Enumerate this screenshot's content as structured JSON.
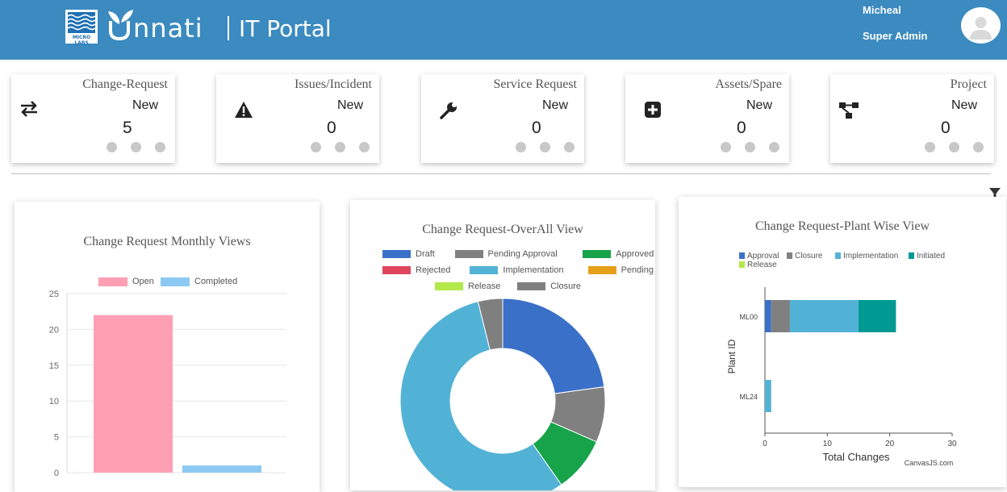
{
  "header": {
    "logo_text": "MICRO LABS",
    "brand_name": "nnati",
    "portal_label": "IT Portal",
    "user_name": "Micheal",
    "user_role": "Super Admin",
    "accent": "#3b8ac0"
  },
  "cards": [
    {
      "title": "Change-Request",
      "status": "New",
      "count": "5",
      "icon": "swap-arrows-icon"
    },
    {
      "title": "Issues/Incident",
      "status": "New",
      "count": "0",
      "icon": "warning-icon"
    },
    {
      "title": "Service Request",
      "status": "New",
      "count": "0",
      "icon": "wrench-icon"
    },
    {
      "title": "Assets/Spare",
      "status": "New",
      "count": "0",
      "icon": "plus-square-icon"
    },
    {
      "title": "Project",
      "status": "New",
      "count": "0",
      "icon": "hierarchy-icon"
    }
  ],
  "chart_data": [
    {
      "type": "bar",
      "title": "Change Request Monthly Views",
      "series": [
        {
          "name": "Open",
          "values": [
            22
          ],
          "color": "#ff9fb4"
        },
        {
          "name": "Completed",
          "values": [
            1
          ],
          "color": "#8cc9f2"
        }
      ],
      "ylim": [
        0,
        25
      ],
      "yticks": [
        "0",
        "5",
        "10",
        "15",
        "20",
        "25"
      ],
      "grid": true,
      "legend": "top"
    },
    {
      "type": "pie",
      "title": "Change Request-OverAll View",
      "legend": "top",
      "categories": [
        "Draft",
        "Pending Approval",
        "Approved",
        "Rejected",
        "Implementation",
        "Pending",
        "Release",
        "Closure"
      ],
      "values": [
        4.7,
        1.8,
        1.8,
        0,
        11.5,
        0,
        0,
        0.8
      ],
      "colors": [
        "#3b70c9",
        "#808080",
        "#16a34a",
        "#e0455f",
        "#52b2d6",
        "#e5a019",
        "#b3e94b",
        "#7f7f7f"
      ]
    },
    {
      "type": "bar",
      "orientation": "horizontal",
      "stacked": true,
      "title": "Change Request-Plant Wise View",
      "xlabel": "Total Changes",
      "ylabel": "Plant ID",
      "categories": [
        "ML00",
        "ML24"
      ],
      "series": [
        {
          "name": "Approval",
          "values": [
            1,
            0
          ],
          "color": "#3b70c9"
        },
        {
          "name": "Closure",
          "values": [
            3,
            0
          ],
          "color": "#808080"
        },
        {
          "name": "Implementation",
          "values": [
            11,
            1
          ],
          "color": "#52b2d6"
        },
        {
          "name": "Initiated",
          "values": [
            6,
            0
          ],
          "color": "#009a93"
        },
        {
          "name": "Release",
          "values": [
            0,
            0
          ],
          "color": "#b3e94b"
        }
      ],
      "xlim": [
        0,
        30
      ],
      "xticks": [
        "0",
        "10",
        "20",
        "30"
      ],
      "credit": "CanvasJS.com",
      "legend": "top"
    }
  ]
}
